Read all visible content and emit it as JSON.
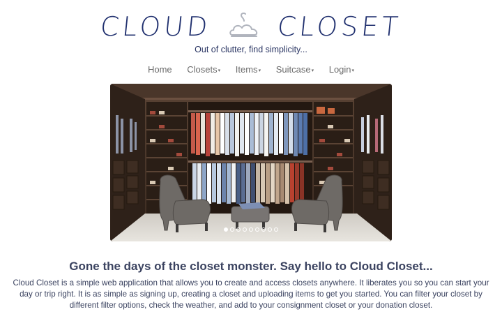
{
  "brand": {
    "left_word": "CLOUD",
    "right_word": "CLOSET",
    "logo_icon": "hanger-cloud-icon",
    "color": "#1f2f6e"
  },
  "tagline": "Out of clutter, find simplicity...",
  "nav": {
    "items": [
      {
        "label": "Home",
        "dropdown": false
      },
      {
        "label": "Closets",
        "dropdown": true
      },
      {
        "label": "Items",
        "dropdown": true
      },
      {
        "label": "Suitcase",
        "dropdown": true
      },
      {
        "label": "Login",
        "dropdown": true
      }
    ],
    "caret": "▾"
  },
  "carousel": {
    "slide_count": 9,
    "active_index": 0,
    "image": "walk-in-closet-photo"
  },
  "content": {
    "headline": "Gone the days of the closet monster. Say hello to Cloud Closet...",
    "description": "Cloud Closet is a simple web application that allows you to create and access closets anywhere. It liberates you so you can start your day or trip right. It is as simple as signing up, creating a closet and uploading items to get you started. You can filter your closet by different filter options, check the weather, and add to your consignment closet or your donation closet."
  }
}
